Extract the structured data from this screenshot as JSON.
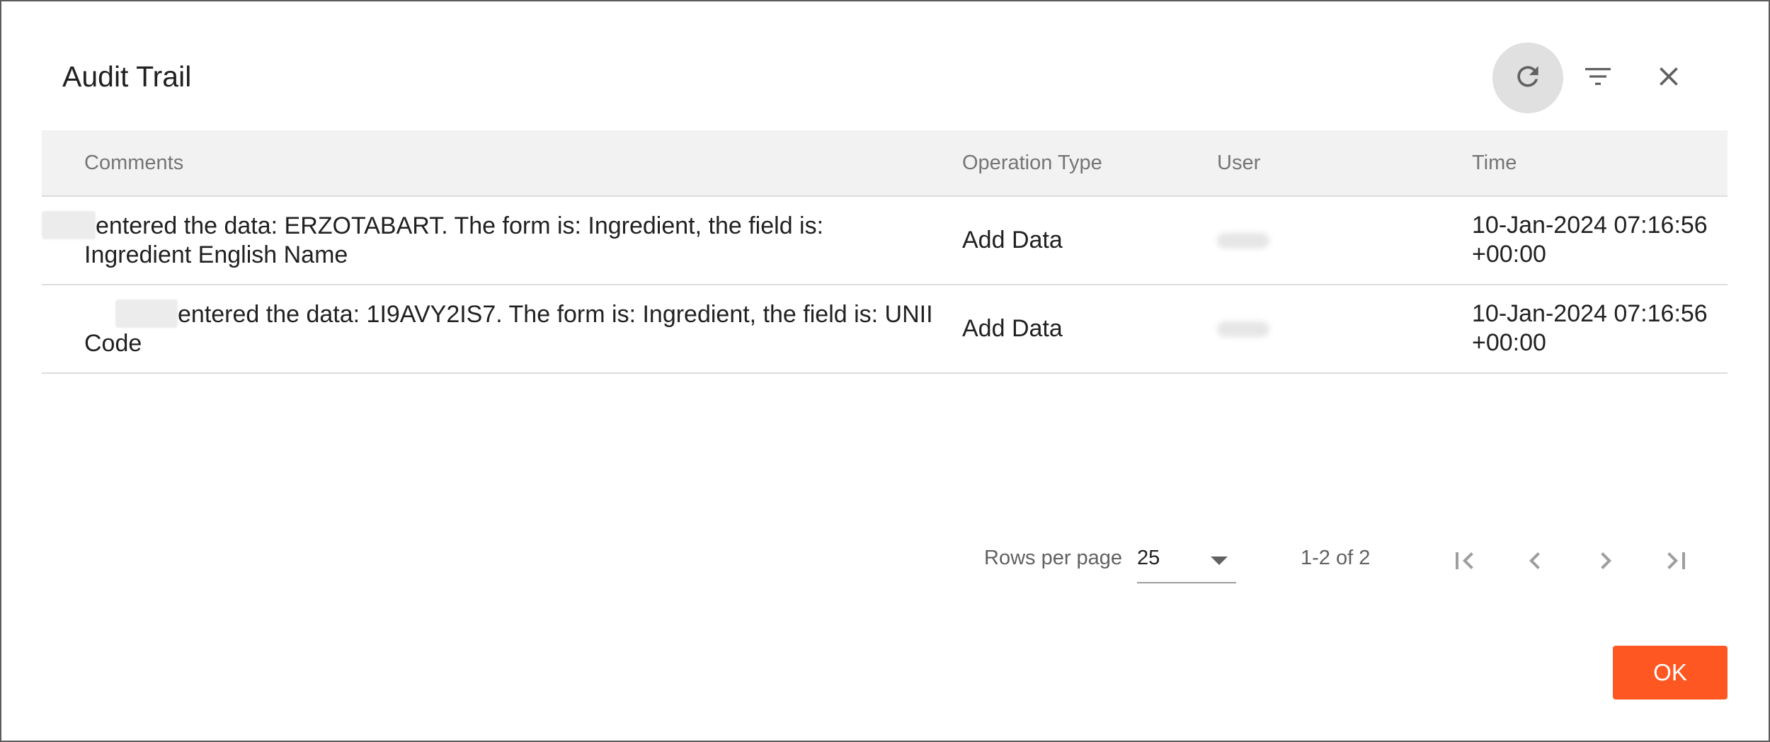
{
  "dialog": {
    "title": "Audit Trail",
    "toolbar": {
      "refresh_icon": "refresh-icon",
      "filter_icon": "filter-icon",
      "close_icon": "close-icon"
    }
  },
  "table": {
    "columns": [
      "Comments",
      "Operation Type",
      "User",
      "Time"
    ],
    "rows": [
      {
        "comment": "entered the data: ERZOTABART. The form is: Ingredient, the field is: Ingredient English Name",
        "operation": "Add Data",
        "time": "10-Jan-2024 07:16:56 +00:00"
      },
      {
        "comment": "entered the data: 1I9AVY2IS7. The form is: Ingredient, the field is: UNII Code",
        "operation": "Add Data",
        "time": "10-Jan-2024 07:16:56 +00:00"
      }
    ]
  },
  "pagination": {
    "rows_per_page_label": "Rows per page",
    "rows_per_page_value": "25",
    "range_label": "1-2 of 2"
  },
  "footer": {
    "ok_label": "OK"
  },
  "colors": {
    "accent": "#ff5722",
    "header_bg": "#f2f2f2"
  }
}
